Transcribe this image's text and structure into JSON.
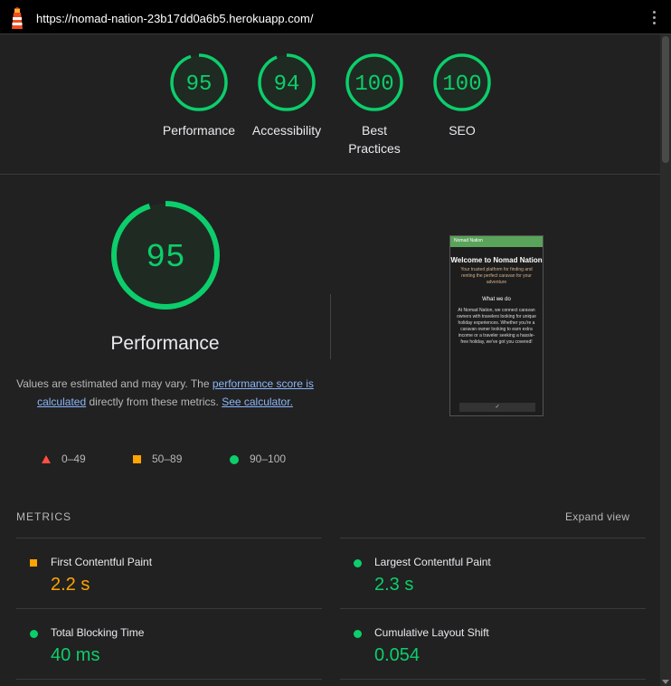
{
  "topbar": {
    "url": "https://nomad-nation-23b17dd0a6b5.herokuapp.com/",
    "lighthouse_icon": "lighthouse-icon",
    "menu_icon": "kebab-menu-icon"
  },
  "gauges": [
    {
      "score": "95",
      "label": "Performance"
    },
    {
      "score": "94",
      "label": "Accessibility"
    },
    {
      "score": "100",
      "label": "Best Practices"
    },
    {
      "score": "100",
      "label": "SEO"
    }
  ],
  "performance": {
    "score": "95",
    "title": "Performance",
    "desc_prefix": "Values are estimated and may vary. The ",
    "desc_link1": "performance score is calculated",
    "desc_middle": " directly from these metrics. ",
    "desc_link2": "See calculator."
  },
  "screenshot": {
    "nav": "Nomad Nation",
    "heading": "Welcome to Nomad Nation",
    "subheading": "Your trusted platform for finding and renting the perfect caravan for your adventure",
    "section": "What we do",
    "body": "At Nomad Nation, we connect caravan owners with travelers looking for unique holiday experiences. Whether you're a caravan owner looking to earn extra income or a traveler seeking a hassle-free holiday, we've got you covered!",
    "button": "✓"
  },
  "legend": [
    {
      "range": "0–49",
      "color": "#ff4e42"
    },
    {
      "range": "50–89",
      "color": "#ffa400"
    },
    {
      "range": "90–100",
      "color": "#0cce6b"
    }
  ],
  "metrics": {
    "heading": "METRICS",
    "expand_label": "Expand view",
    "items": [
      {
        "name": "First Contentful Paint",
        "value": "2.2 s",
        "status": "average"
      },
      {
        "name": "Largest Contentful Paint",
        "value": "2.3 s",
        "status": "pass"
      },
      {
        "name": "Total Blocking Time",
        "value": "40 ms",
        "status": "pass"
      },
      {
        "name": "Cumulative Layout Shift",
        "value": "0.054",
        "status": "pass"
      }
    ]
  },
  "colors": {
    "pass": "#0cce6b",
    "average": "#ffa400",
    "fail": "#ff4e42",
    "background": "#212121"
  }
}
